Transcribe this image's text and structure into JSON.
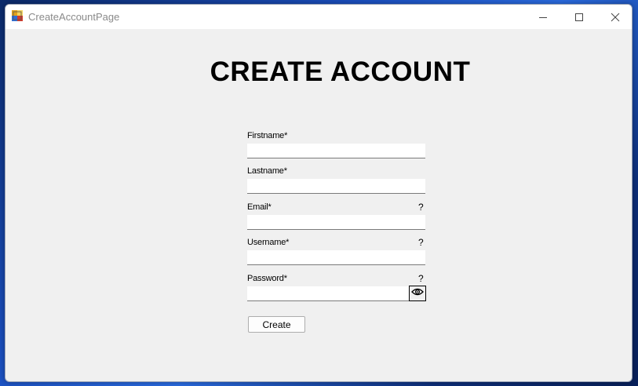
{
  "window": {
    "title": "CreateAccountPage"
  },
  "form": {
    "heading": "CREATE ACCOUNT",
    "firstname_label": "Firstname*",
    "lastname_label": "Lastname*",
    "email_label": "Email*",
    "username_label": "Username*",
    "password_label": "Password*",
    "help_marker": "?",
    "firstname_value": "",
    "lastname_value": "",
    "email_value": "",
    "username_value": "",
    "password_value": "",
    "create_label": "Create"
  },
  "icons": {
    "app": "app-icon",
    "minimize": "minimize-icon",
    "maximize": "maximize-icon",
    "close": "close-icon",
    "show_password": "eye-icon"
  }
}
